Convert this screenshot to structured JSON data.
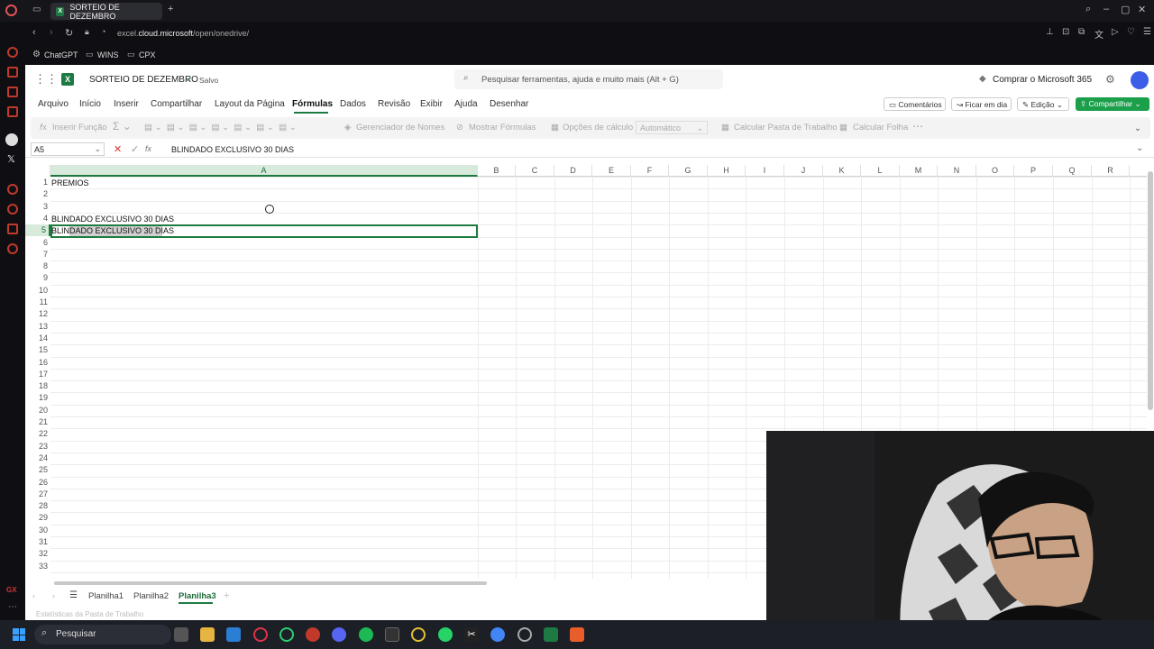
{
  "browser": {
    "tab_title": "SORTEIO DE DEZEMBRO",
    "url_pre": "excel.",
    "url_host": "cloud.microsoft",
    "url_path": "/open/onedrive/",
    "bookmarks": [
      "ChatGPT",
      "WINS",
      "CPX"
    ]
  },
  "excel": {
    "workbook_title": "SORTEIO DE DEZEMBRO",
    "save_status": "Salvo",
    "search_placeholder": "Pesquisar ferramentas, ajuda e muito mais (Alt + G)",
    "buy_label": "Comprar o Microsoft 365",
    "menu": [
      "Arquivo",
      "Início",
      "Inserir",
      "Compartilhar",
      "Layout da Página",
      "Fórmulas",
      "Dados",
      "Revisão",
      "Exibir",
      "Ajuda",
      "Desenhar"
    ],
    "active_menu": "Fórmulas",
    "comments_label": "Comentários",
    "catchup_label": "Ficar em dia",
    "editing_label": "Edição",
    "share_label": "Compartilhar",
    "ribbon": {
      "insert_function": "Inserir Função",
      "name_manager": "Gerenciador de Nomes",
      "show_formulas": "Mostrar Fórmulas",
      "calc_options": "Opções de cálculo",
      "calc_mode": "Automático",
      "calc_workbook": "Calcular Pasta de Trabalho",
      "calc_sheet": "Calcular Folha"
    },
    "name_box": "A5",
    "formula": "BLINDADO EXCLUSIVO 30 DIAS",
    "columns": [
      "A",
      "B",
      "C",
      "D",
      "E",
      "F",
      "G",
      "H",
      "I",
      "J",
      "K",
      "L",
      "M",
      "N",
      "O",
      "P",
      "Q",
      "R"
    ],
    "rows": [
      "1",
      "2",
      "3",
      "4",
      "5",
      "6",
      "7",
      "8",
      "9",
      "10",
      "11",
      "12",
      "13",
      "14",
      "15",
      "16",
      "17",
      "18",
      "19",
      "20",
      "21",
      "22",
      "23",
      "24",
      "25",
      "26",
      "27",
      "28",
      "29",
      "30",
      "31",
      "32",
      "33"
    ],
    "cells": {
      "A1": "PREMIOS",
      "A4": "BLINDADO EXCLUSIVO 30 DIAS",
      "A5": "BLINDADO EXCLUSIVO 30 DIAS"
    },
    "sheets": [
      "Planilha1",
      "Planilha2",
      "Planilha3"
    ],
    "active_sheet": "Planilha3",
    "status_text": "Estatísticas da Pasta de Trabalho"
  },
  "taskbar": {
    "search_label": "Pesquisar"
  },
  "colors": {
    "excel_green": "#1d7a43",
    "selection_border": "#1f7a3f",
    "share_button": "#1c9f4b"
  }
}
